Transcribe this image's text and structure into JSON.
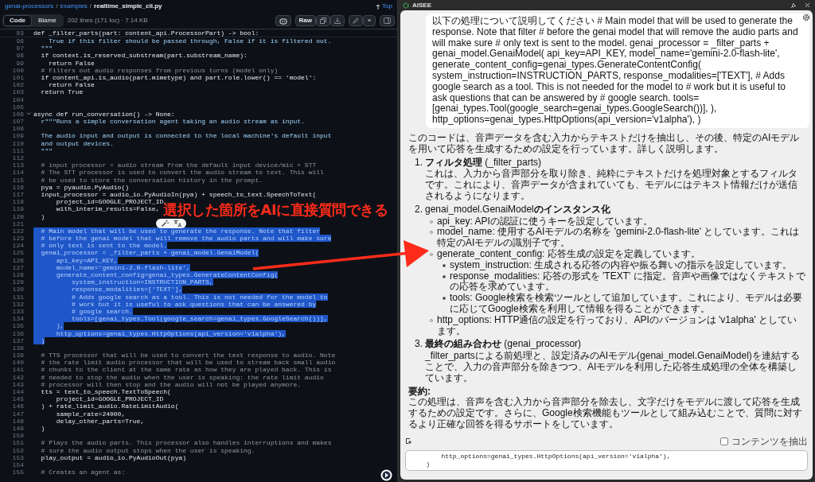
{
  "code_view": {
    "breadcrumb": [
      "genai-processors",
      "examples",
      "realtime_simple_cli.py"
    ],
    "separator": "/",
    "top_link": "Top",
    "tabs": [
      {
        "label": "Code",
        "selected": true
      },
      {
        "label": "Blame",
        "selected": false
      }
    ],
    "file_info": "202 lines (171 loc) · 7.14 KB",
    "raw_button": "Raw",
    "sticky_line": {
      "number": "83",
      "text": "def _filter_parts(part: content_api.ProcessorPart) -> bool:",
      "kind": "code"
    },
    "lines": [
      {
        "number": "96",
        "text": "    True if this filter should be passed through, False if it is filtered out.",
        "kind": "string",
        "selected": false,
        "foldable": false
      },
      {
        "number": "97",
        "text": "  \"\"\"",
        "kind": "string",
        "selected": false,
        "foldable": false
      },
      {
        "number": "98",
        "text": "  if context.is_reserved_substream(part.substream_name):",
        "kind": "code",
        "selected": false,
        "foldable": false
      },
      {
        "number": "99",
        "text": "    return False",
        "kind": "code",
        "selected": false,
        "foldable": false
      },
      {
        "number": "100",
        "text": "  # Filters out audio responses from previous turns (model only)",
        "kind": "comment",
        "selected": false,
        "foldable": false
      },
      {
        "number": "101",
        "text": "  if content_api.is_audio(part.mimetype) and part.role.lower() == 'model':",
        "kind": "code",
        "selected": false,
        "foldable": false
      },
      {
        "number": "102",
        "text": "    return False",
        "kind": "code",
        "selected": false,
        "foldable": false
      },
      {
        "number": "103",
        "text": "  return True",
        "kind": "code",
        "selected": false,
        "foldable": false
      },
      {
        "number": "104",
        "foldable": false
      },
      {
        "number": "105",
        "foldable": false
      },
      {
        "number": "106",
        "text": "async def run_conversation() -> None:",
        "kind": "code",
        "selected": false,
        "foldable": true
      },
      {
        "number": "107",
        "text": "  r\"\"\"Runs a simple conversation agent taking an audio stream as input.",
        "kind": "string",
        "selected": false,
        "foldable": false
      },
      {
        "number": "108",
        "foldable": false
      },
      {
        "number": "109",
        "text": "  The audio input and output is connected to the local machine's default input",
        "kind": "string",
        "selected": false,
        "foldable": false
      },
      {
        "number": "110",
        "text": "  and output devices.",
        "kind": "string",
        "selected": false,
        "foldable": false
      },
      {
        "number": "111",
        "text": "  \"\"\"",
        "kind": "string",
        "selected": false,
        "foldable": false
      },
      {
        "number": "112",
        "foldable": false
      },
      {
        "number": "113",
        "text": "  # input processor = audio stream from the default input device/mic + STT",
        "kind": "comment",
        "selected": false,
        "foldable": false
      },
      {
        "number": "114",
        "text": "  # The STT processor is used to convert the audio stream to text. This will",
        "kind": "comment",
        "selected": false,
        "foldable": false
      },
      {
        "number": "115",
        "text": "  # be used to store the conversation history in the prompt.",
        "kind": "comment",
        "selected": false,
        "foldable": false
      },
      {
        "number": "116",
        "text": "  pya = pyaudio.PyAudio()",
        "kind": "code",
        "selected": false,
        "foldable": false
      },
      {
        "number": "117",
        "text": "  input_processor = audio_io.PyAudioIn(pya) + speech_to_text.SpeechToText(",
        "kind": "code",
        "selected": false,
        "foldable": false
      },
      {
        "number": "118",
        "text": "      project_id=GOOGLE_PROJECT_ID,",
        "kind": "code",
        "selected": false,
        "foldable": false
      },
      {
        "number": "119",
        "text": "      with_interim_results=False,",
        "kind": "code",
        "selected": false,
        "foldable": false
      },
      {
        "number": "120",
        "text": "  )",
        "kind": "code",
        "selected": false,
        "foldable": false
      },
      {
        "number": "121",
        "foldable": false
      },
      {
        "number": "122",
        "text": "  # Main model that will be used to generate the response. Note that filter",
        "kind": "comment",
        "selected": true,
        "foldable": false
      },
      {
        "number": "123",
        "text": "  # before the genai model that will remove the audio parts and will make sure",
        "kind": "comment",
        "selected": true,
        "foldable": false
      },
      {
        "number": "124",
        "text": "  # only text is sent to the model.",
        "kind": "comment",
        "selected": true,
        "foldable": false
      },
      {
        "number": "125",
        "text": "  genai_processor = _filter_parts + genai_model.GenaiModel(",
        "kind": "code",
        "selected": true,
        "foldable": false
      },
      {
        "number": "126",
        "text": "      api_key=API_KEY,",
        "kind": "code",
        "selected": true,
        "foldable": false
      },
      {
        "number": "127",
        "text": "      model_name='gemini-2.0-flash-lite',",
        "kind": "code",
        "selected": true,
        "foldable": false
      },
      {
        "number": "128",
        "text": "      generate_content_config=genai_types.GenerateContentConfig(",
        "kind": "code",
        "selected": true,
        "foldable": false
      },
      {
        "number": "129",
        "text": "          system_instruction=INSTRUCTION_PARTS,",
        "kind": "code",
        "selected": true,
        "foldable": false
      },
      {
        "number": "130",
        "text": "          response_modalities=['TEXT'],",
        "kind": "code",
        "selected": true,
        "foldable": false
      },
      {
        "number": "131",
        "text": "          # Adds google search as a tool. This is not needed for the model to",
        "kind": "comment",
        "selected": true,
        "foldable": false
      },
      {
        "number": "132",
        "text": "          # work but it is useful to ask questions that can be answered by",
        "kind": "comment",
        "selected": true,
        "foldable": false
      },
      {
        "number": "133",
        "text": "          # google search.",
        "kind": "comment",
        "selected": true,
        "foldable": false
      },
      {
        "number": "134",
        "text": "          tools=[genai_types.Tool(google_search=genai_types.GoogleSearch())],",
        "kind": "code",
        "selected": true,
        "foldable": false
      },
      {
        "number": "135",
        "text": "      ),",
        "kind": "code",
        "selected": true,
        "foldable": false
      },
      {
        "number": "136",
        "text": "      http_options=genai_types.HttpOptions(api_version='v1alpha'),",
        "kind": "code",
        "selected": true,
        "foldable": false
      },
      {
        "number": "137",
        "text": "  )",
        "kind": "code",
        "selected": true,
        "foldable": false
      },
      {
        "number": "138",
        "foldable": false
      },
      {
        "number": "139",
        "text": "  # TTS processor that will be used to convert the text response to audio. Note",
        "kind": "comment",
        "selected": false,
        "foldable": false
      },
      {
        "number": "140",
        "text": "  # the rate limit audio processor that will be used to stream back small audio",
        "kind": "comment",
        "selected": false,
        "foldable": false
      },
      {
        "number": "141",
        "text": "  # chunks to the client at the same rate as how they are played back. This is",
        "kind": "comment",
        "selected": false,
        "foldable": false
      },
      {
        "number": "142",
        "text": "  # needed to stop the audio when the user is speaking: the rate limit audio",
        "kind": "comment",
        "selected": false,
        "foldable": false
      },
      {
        "number": "143",
        "text": "  # processor will then stop and the audio will not be played anymore.",
        "kind": "comment",
        "selected": false,
        "foldable": false
      },
      {
        "number": "144",
        "text": "  tts = text_to_speech.TextToSpeech(",
        "kind": "code",
        "selected": false,
        "foldable": false
      },
      {
        "number": "145",
        "text": "      project_id=GOOGLE_PROJECT_ID",
        "kind": "code",
        "selected": false,
        "foldable": false
      },
      {
        "number": "146",
        "text": "  ) + rate_limit_audio.RateLimitAudio(",
        "kind": "code",
        "selected": false,
        "foldable": false
      },
      {
        "number": "147",
        "text": "      sample_rate=24000,",
        "kind": "code",
        "selected": false,
        "foldable": false
      },
      {
        "number": "148",
        "text": "      delay_other_parts=True,",
        "kind": "code",
        "selected": false,
        "foldable": false
      },
      {
        "number": "149",
        "text": "  )",
        "kind": "code",
        "selected": false,
        "foldable": false
      },
      {
        "number": "150",
        "foldable": false
      },
      {
        "number": "151",
        "text": "  # Plays the audio parts. This processor also handles interruptions and makes",
        "kind": "comment",
        "selected": false,
        "foldable": false
      },
      {
        "number": "152",
        "text": "  # sure the audio output stops when the user is speaking.",
        "kind": "comment",
        "selected": false,
        "foldable": false
      },
      {
        "number": "153",
        "text": "  play_output = audio_io.PyAudioOut(pya)",
        "kind": "code",
        "selected": false,
        "foldable": false
      },
      {
        "number": "154",
        "foldable": false
      },
      {
        "number": "155",
        "text": "  # Creates an agent as:",
        "kind": "comment",
        "selected": false,
        "foldable": false
      }
    ]
  },
  "annotation": {
    "text": "選択した箇所をAIに直接質問できる"
  },
  "assistant_panel": {
    "title": "AISEE",
    "user_message": "以下の処理について説明してください # Main model that will be used to generate the response. Note that filter # before the genai model that will remove the audio parts and will make sure # only text is sent to the model. genai_processor = _filter_parts + genai_model.GenaiModel( api_key=API_KEY, model_name='gemini-2.0-flash-lite', generate_content_config=genai_types.GenerateContentConfig( system_instruction=INSTRUCTION_PARTS, response_modalities=['TEXT'], # Adds google search as a tool. This is not needed for the model to # work but it is useful to ask questions that can be answered by # google search. tools=[genai_types.Tool(google_search=genai_types.GoogleSearch())], ), http_options=genai_types.HttpOptions(api_version='v1alpha'), )",
    "response": {
      "intro": "このコードは、音声データを含む入力からテキストだけを抽出し、その後、特定のAIモデルを用いて応答を生成するための設定を行っています。詳しく説明します。",
      "items": [
        {
          "number": "1.",
          "title": "**フィルタ処理** (_filter_parts)",
          "body": "これは、入力から音声部分を取り除き、純粋にテキストだけを処理対象とするフィルタです。これにより、音声データが含まれていても、モデルにはテキスト情報だけが送信されるようになります。"
        },
        {
          "number": "2.",
          "title": "genai_model.GenaiModel**のインスタンス化**",
          "bullets": [
            {
              "text": "api_key: APIの認証に使うキーを設定しています。"
            },
            {
              "text": "model_name: 使用するAIモデルの名称を 'gemini-2.0-flash-lite' としています。これは特定のAIモデルの識別子です。"
            },
            {
              "text": "generate_content_config: 応答生成の設定を定義しています。",
              "children": [
                {
                  "text": "system_instruction: 生成される応答の内容や振る舞いの指示を設定しています。"
                },
                {
                  "text": "response_modalities: 応答の形式を 'TEXT' に指定。音声や画像ではなくテキストでの応答を求めています。"
                },
                {
                  "text": "tools: Google検索を検索ツールとして追加しています。これにより、モデルは必要に応じてGoogle検索を利用して情報を得ることができます。"
                }
              ]
            },
            {
              "text": "http_options: HTTP通信の設定を行っており、APIのバージョンは 'v1alpha' としています。"
            }
          ]
        },
        {
          "number": "3.",
          "title": "**最終の組み合わせ** (genai_processor)",
          "body": "_filter_partsによる前処理と、設定済みのAIモデル(genai_model.GenaiModel)を連結することで、入力の音声部分を除きつつ、AIモデルを利用した応答生成処理の全体を構築しています。"
        }
      ],
      "summary_heading": "要約:",
      "summary": "この処理は、音声を含む入力から音声部分を除去し、文字だけをモデルに渡して応答を生成するための設定です。さらに、Google検索機能もツールとして組み込むことで、質問に対するより正確な回答を得るサポートをしています。"
    },
    "extract_checkbox": {
      "label": "コンテンツを抽出",
      "checked": false
    },
    "input": {
      "value": "        http_options=genai_types.HttpOptions(api_version='v1alpha'),\n    )"
    }
  }
}
